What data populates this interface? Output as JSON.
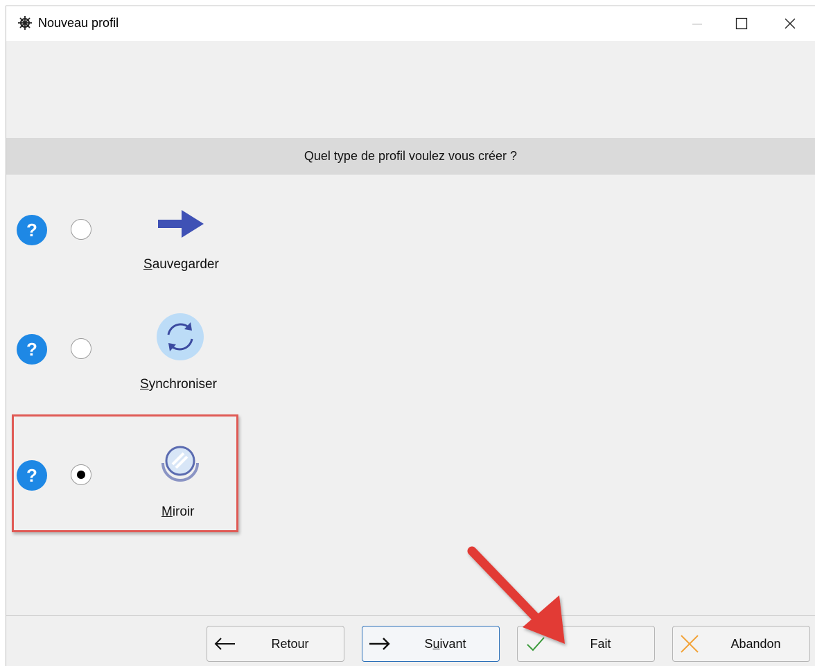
{
  "window": {
    "title": "Nouveau profil"
  },
  "question": "Quel type de profil voulez vous créer ?",
  "options": [
    {
      "label_first": "S",
      "label_rest": "auvegarder",
      "icon": "arrow-right-icon",
      "selected": false
    },
    {
      "label_first": "S",
      "label_rest": "ynchroniser",
      "icon": "sync-icon",
      "selected": false
    },
    {
      "label_first": "M",
      "label_rest": "iroir",
      "icon": "mirror-icon",
      "selected": true
    }
  ],
  "buttons": {
    "back": {
      "label": "Retour"
    },
    "next": {
      "label_pre": "S",
      "label_ul": "u",
      "label_post": "ivant"
    },
    "done": {
      "label": "Fait"
    },
    "cancel": {
      "label": "Abandon"
    }
  },
  "colors": {
    "help_blue": "#1e88e5",
    "highlight_red": "#e05a55",
    "arrow_red": "#e23b34",
    "check_green": "#3a9a3a",
    "cancel_orange": "#f2a33a"
  }
}
